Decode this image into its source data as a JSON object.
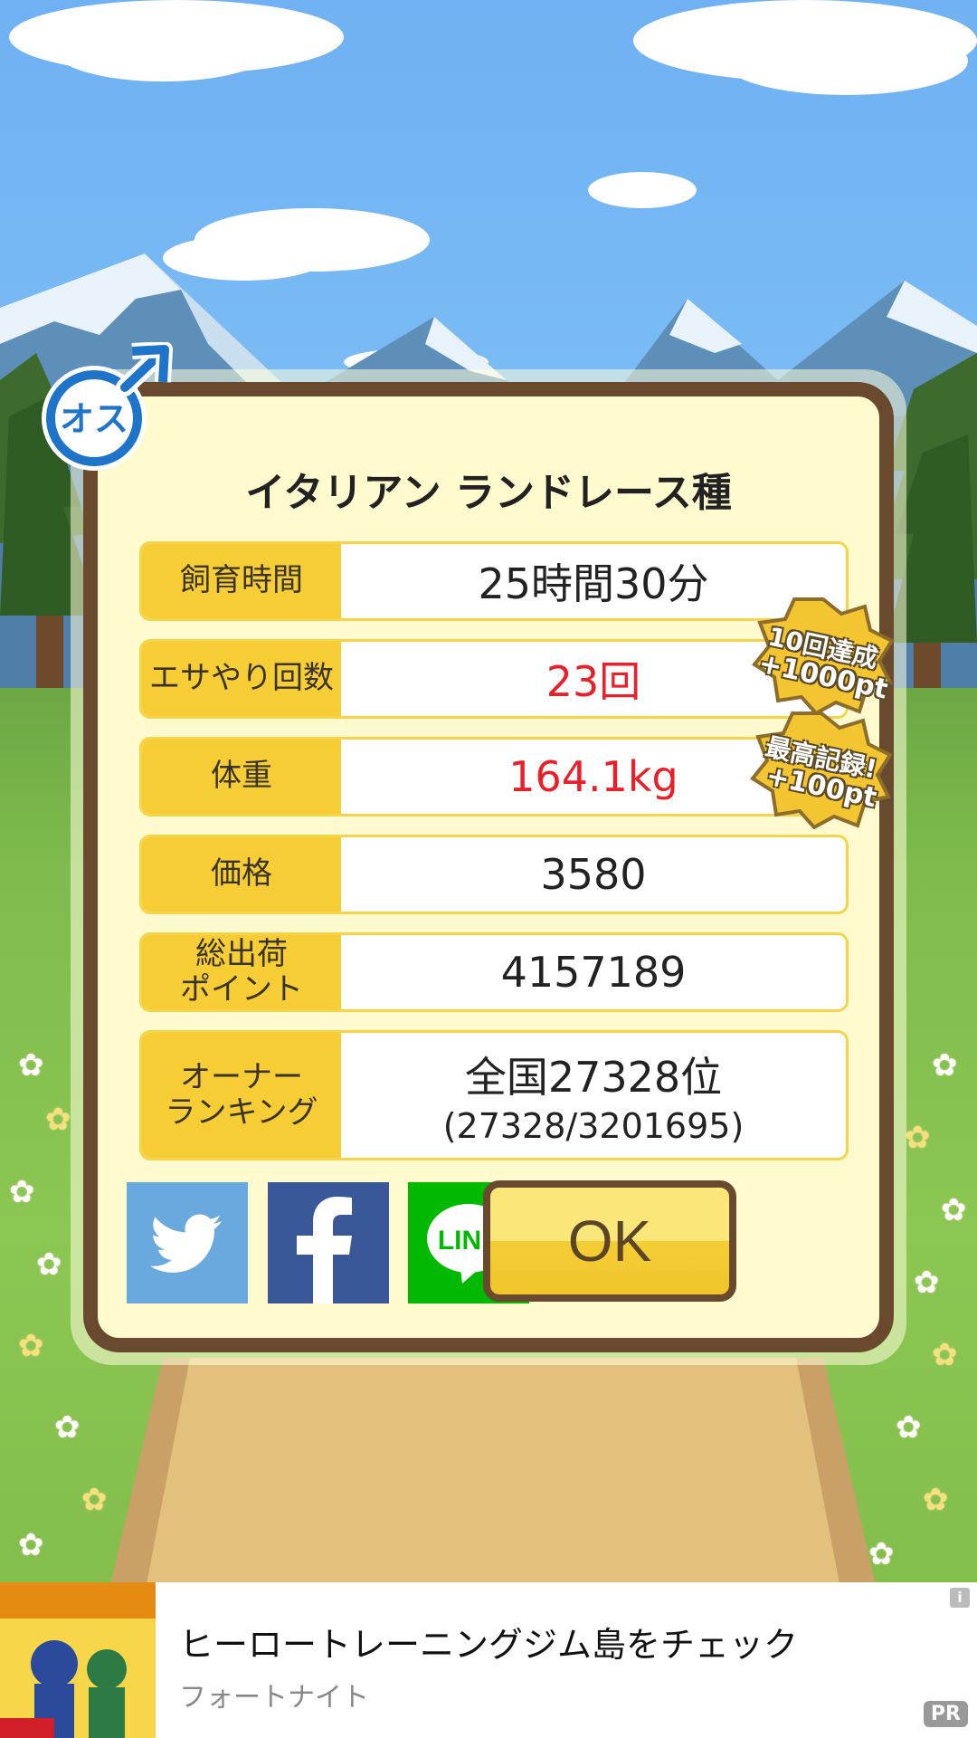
{
  "dialog": {
    "gender_badge": "オス",
    "title": "イタリアン ランドレース種",
    "stats": [
      {
        "label": "飼育時間",
        "value": "25時間30分"
      },
      {
        "label": "エサやり回数",
        "value": "23回"
      },
      {
        "label": "体重",
        "value": "164.1kg"
      },
      {
        "label": "価格",
        "value": "3580"
      },
      {
        "label": "総出荷\nポイント",
        "value": "4157189"
      },
      {
        "label": "オーナー\nランキング",
        "value": "全国27328位",
        "sub": "(27328/3201695)"
      }
    ],
    "stickers": [
      {
        "line1": "10回達成",
        "line2": "+1000pt"
      },
      {
        "line1": "最高記録!",
        "line2": "+100pt"
      }
    ],
    "share": {
      "line_label": "LINE"
    },
    "ok_label": "OK"
  },
  "ad": {
    "title": "ヒーロートレーニングジム島をチェック",
    "advertiser": "フォートナイト",
    "info": "i",
    "pr": "PR"
  },
  "colors": {
    "label_bg": "#f7cd35",
    "highlight_value": "#e8202a",
    "dialog_border": "#6a4a2e",
    "twitter": "#6aa9de",
    "facebook": "#3a5897",
    "line": "#00b900"
  }
}
